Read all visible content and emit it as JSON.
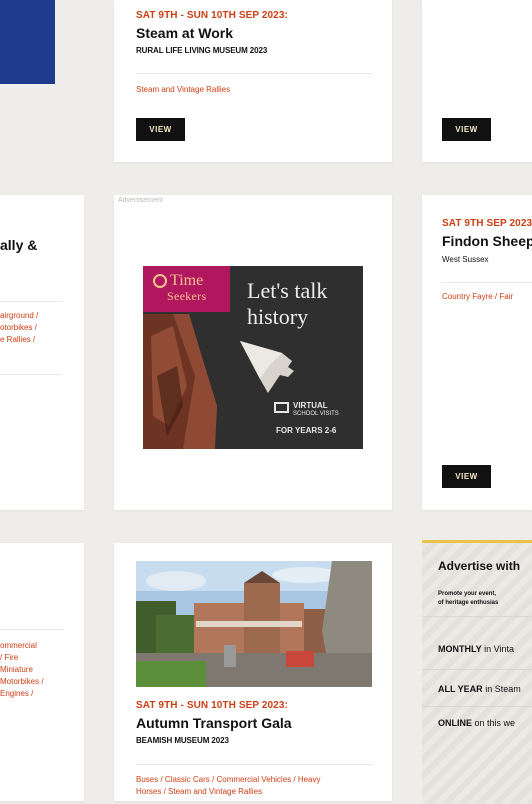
{
  "cards": {
    "steam": {
      "date": "SAT 9TH - SUN 10TH SEP 2023:",
      "title": "Steam at Work",
      "venue": "RURAL LIFE LIVING MUSEUM 2023",
      "categories": [
        "Steam and Vintage Rallies"
      ],
      "view_label": "VIEW"
    },
    "top_right": {
      "view_label": "VIEW"
    },
    "left_mid": {
      "title_partial": "ally &",
      "categories": [
        "airground /",
        "otorbikes /",
        "e Rallies /"
      ]
    },
    "findon": {
      "date": "SAT 9TH SEP 2023",
      "title": "Findon Sheep",
      "region": "West Sussex",
      "categories": [
        "Country Fayre / Fair"
      ],
      "view_label": "VIEW"
    },
    "left_bottom": {
      "categories": [
        "ommercial",
        "/ Fire",
        "Miniature",
        "Motorbikes /",
        "Engines /"
      ]
    },
    "autumn": {
      "date": "SAT 9TH - SUN 10TH SEP 2023:",
      "title": "Autumn Transport Gala",
      "venue": "BEAMISH MUSEUM 2023",
      "categories_line1": "Buses / Classic Cars / Commercial Vehicles / Heavy",
      "categories_line2": "Horses / Steam and Vintage Rallies"
    }
  },
  "ad": {
    "label": "Advertisement",
    "brand_top": "Time",
    "brand_bottom": "Seekers",
    "headline_1": "Let's talk",
    "headline_2": "history",
    "badge_1": "VIRTUAL",
    "badge_2": "SCHOOL VISITS",
    "badge_3": "FOR YEARS 2-6"
  },
  "advertise": {
    "title": "Advertise with",
    "blurb_1": "Promote your event,",
    "blurb_2": "of heritage enthusias",
    "rows": [
      {
        "bold": "MONTHLY",
        "rest": " in Vinta"
      },
      {
        "bold": "ALL YEAR",
        "rest": " in Steam"
      },
      {
        "bold": "ONLINE",
        "rest": " on this we"
      }
    ]
  },
  "colors": {
    "accent_orange": "#cc3e13",
    "ad_magenta": "#b0175f",
    "button_black": "#111111",
    "banner_navy": "#1e3a8a",
    "advertise_yellow": "#e8c24a"
  }
}
